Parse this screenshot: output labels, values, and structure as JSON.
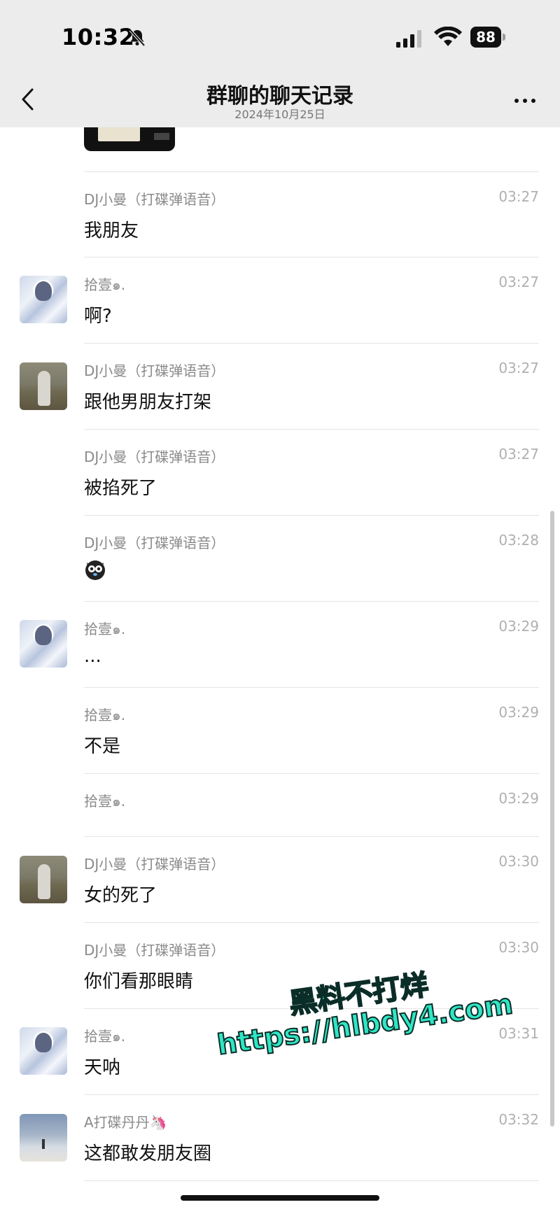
{
  "status_bar": {
    "time": "10:32",
    "battery": "88"
  },
  "nav": {
    "title": "群聊的聊天记录",
    "subtitle": "2024年10月25日"
  },
  "messages": [
    {
      "sender": "DJ小曼（打碟弹语音）",
      "time": "03:27",
      "text": "我朋友"
    },
    {
      "sender": "拾壹๑.",
      "time": "03:27",
      "text": "啊?"
    },
    {
      "sender": "DJ小曼（打碟弹语音）",
      "time": "03:27",
      "text": "跟他男朋友打架"
    },
    {
      "sender": "DJ小曼（打碟弹语音）",
      "time": "03:27",
      "text": "被掐死了"
    },
    {
      "sender": "DJ小曼（打碟弹语音）",
      "time": "03:28",
      "text": ""
    },
    {
      "sender": "拾壹๑.",
      "time": "03:29",
      "text": "..."
    },
    {
      "sender": "拾壹๑.",
      "time": "03:29",
      "text": "不是"
    },
    {
      "sender": "拾壹๑.",
      "time": "03:29",
      "text": ""
    },
    {
      "sender": "DJ小曼（打碟弹语音）",
      "time": "03:30",
      "text": "女的死了"
    },
    {
      "sender": "DJ小曼（打碟弹语音）",
      "time": "03:30",
      "text": "你们看那眼睛"
    },
    {
      "sender": "拾壹๑.",
      "time": "03:31",
      "text": "天呐"
    },
    {
      "sender": "A打碟丹丹🦄",
      "time": "03:32",
      "text": "这都敢发朋友圈"
    }
  ],
  "watermark": {
    "line1": "黑料不打烊",
    "line2": "https://hlbdy4.com"
  }
}
